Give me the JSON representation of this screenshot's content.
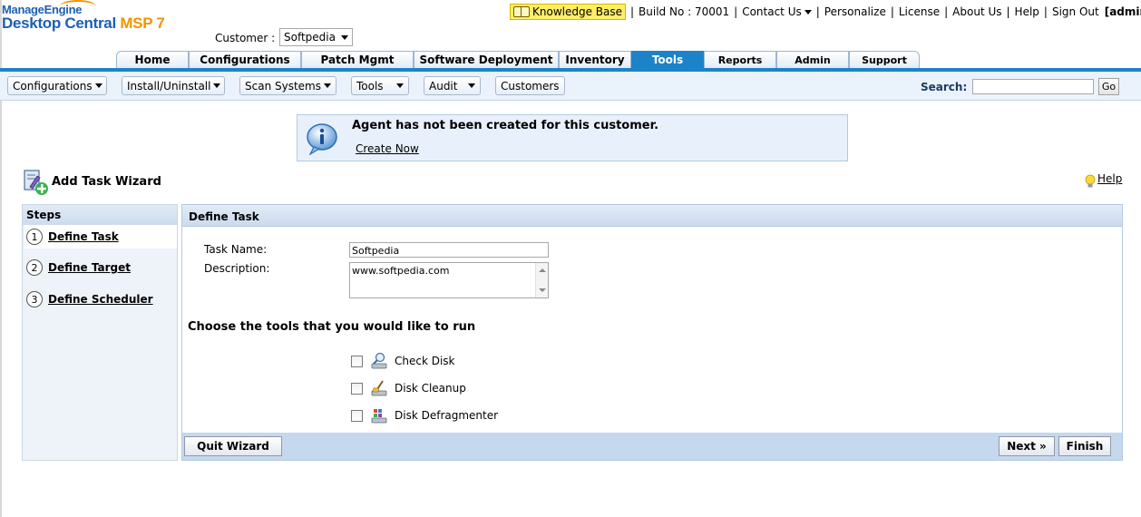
{
  "brand": {
    "line1": "ManageEngine",
    "line2": "Desktop Central",
    "line2_accent": "MSP 7"
  },
  "customer": {
    "label": "Customer :",
    "selected": "Softpedia"
  },
  "topbar": {
    "knowledge_base": "Knowledge Base",
    "build": "Build No : 70001",
    "contact_us": "Contact Us",
    "personalize": "Personalize",
    "license": "License",
    "about": "About Us",
    "help": "Help",
    "sign_out": "Sign Out",
    "user": "[admin]"
  },
  "tabs": [
    {
      "label": "Home"
    },
    {
      "label": "Configurations"
    },
    {
      "label": "Patch Mgmt"
    },
    {
      "label": "Software Deployment"
    },
    {
      "label": "Inventory"
    },
    {
      "label": "Tools"
    },
    {
      "label": "Reports"
    },
    {
      "label": "Admin"
    },
    {
      "label": "Support"
    }
  ],
  "subbar": {
    "items": [
      {
        "label": "Configurations"
      },
      {
        "label": "Install/Uninstall"
      },
      {
        "label": "Scan Systems"
      },
      {
        "label": "Tools"
      },
      {
        "label": "Audit"
      },
      {
        "label": "Customers"
      }
    ],
    "search_label": "Search:",
    "search_value": "",
    "go": "Go"
  },
  "banner": {
    "message": "Agent has not been created for this customer.",
    "action": "Create Now"
  },
  "wizard": {
    "title": "Add Task Wizard",
    "help": "Help",
    "steps_title": "Steps",
    "steps": [
      {
        "num": "1",
        "label": "Define Task"
      },
      {
        "num": "2",
        "label": "Define Target"
      },
      {
        "num": "3",
        "label": "Define Scheduler"
      }
    ],
    "panel_title": "Define Task",
    "task_name_label": "Task Name:",
    "task_name_value": "Softpedia",
    "description_label": "Description:",
    "description_value": "www.softpedia.com",
    "choose_text": "Choose the tools that you would like to run",
    "tools": [
      {
        "label": "Check Disk",
        "checked": false
      },
      {
        "label": "Disk Cleanup",
        "checked": false
      },
      {
        "label": "Disk Defragmenter",
        "checked": false
      }
    ],
    "quit": "Quit Wizard",
    "next": "Next »",
    "finish": "Finish"
  }
}
